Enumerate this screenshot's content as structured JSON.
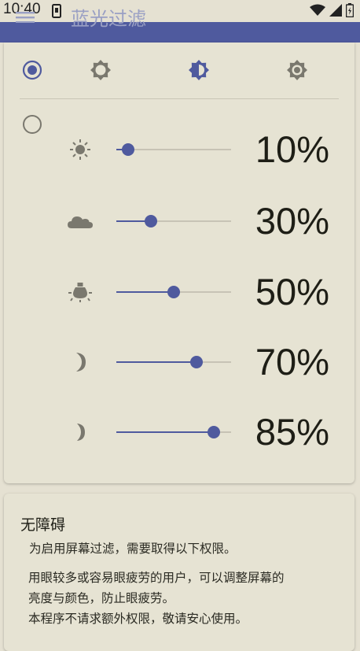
{
  "status_bar": {
    "time": "10:40"
  },
  "app_bar": {
    "title": "蓝光过滤"
  },
  "modes": [
    {
      "icon": "radio-selected-icon",
      "selected": true
    },
    {
      "icon": "brightness-low-icon"
    },
    {
      "icon": "brightness-half-icon",
      "active": true
    },
    {
      "icon": "brightness-auto-icon"
    }
  ],
  "custom": {
    "rows": [
      {
        "icon": "sun-icon",
        "value_percent": 10,
        "label": "10%"
      },
      {
        "icon": "cloud-icon",
        "value_percent": 30,
        "label": "30%"
      },
      {
        "icon": "lamp-icon",
        "value_percent": 50,
        "label": "50%"
      },
      {
        "icon": "moon-icon",
        "value_percent": 70,
        "label": "70%"
      },
      {
        "icon": "moon-small-icon",
        "value_percent": 85,
        "label": "85%"
      }
    ]
  },
  "permissions": {
    "title": "无障碍",
    "line1": "为启用屏幕过滤，需要取得以下权限。",
    "line2": "用眼较多或容易眼疲劳的用户，可以调整屏幕的",
    "line3": "亮度与颜色，防止眼疲劳。",
    "line4": "本程序不请求额外权限，敬请安心使用。"
  },
  "colors": {
    "accent": "#4f5a9e",
    "background": "#e5e1d2",
    "icon_gray": "#7a786e"
  }
}
